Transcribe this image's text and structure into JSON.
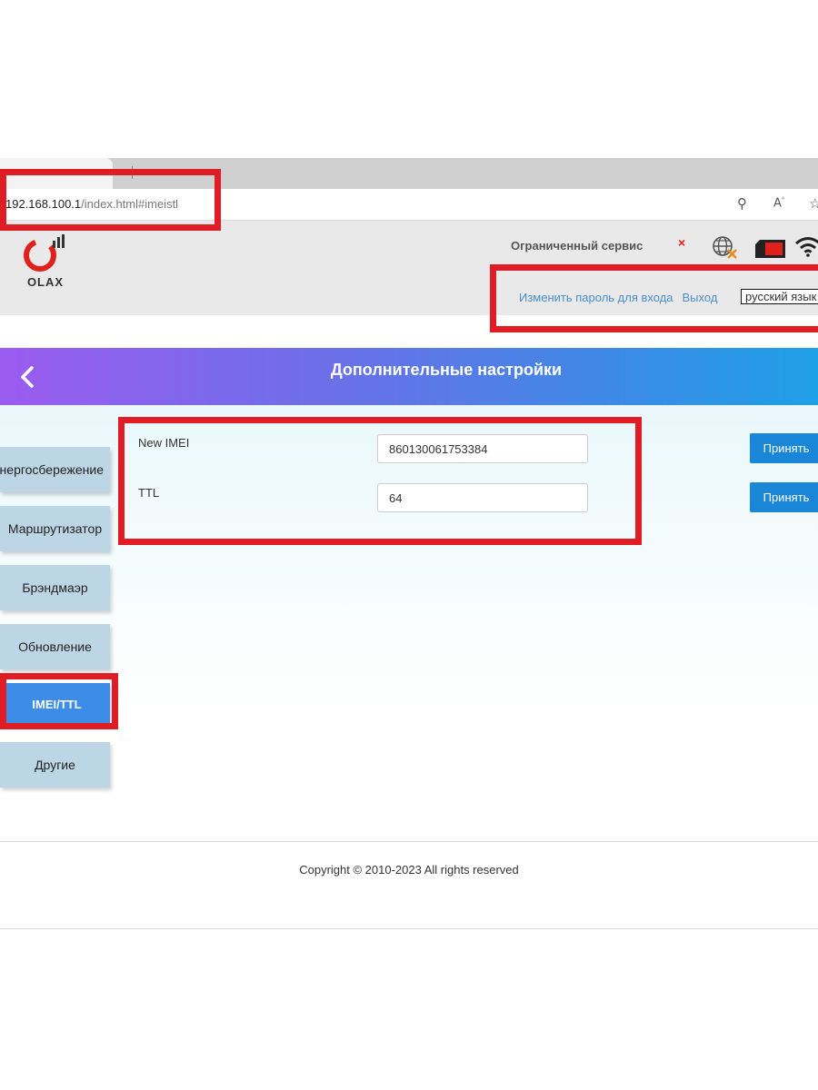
{
  "browser": {
    "url_host": "192.168.100.1",
    "url_path": "/index.html#imeistl",
    "icons": [
      "key-icon",
      "read-aloud-icon",
      "favorite-star-icon"
    ]
  },
  "header": {
    "logo_text": "OLAX",
    "service_status": "Ограниченный сервис",
    "service_status_mark": "×",
    "status_color": "#e0201b",
    "links": {
      "change_password": "Изменить пароль для входа",
      "logout": "Выход"
    },
    "language": "русский язык"
  },
  "banner": {
    "title": "Дополнительные настройки",
    "gradient_colors": [
      "#9b5cf0",
      "#1ea0e6"
    ]
  },
  "sidebar": {
    "items": [
      {
        "label": "Энергосбережение"
      },
      {
        "label": "Маршрутизатор"
      },
      {
        "label": "Брэндмаэр"
      },
      {
        "label": "Обновление"
      },
      {
        "label": "IMEI/TTL"
      },
      {
        "label": "Другие"
      }
    ],
    "active_index": 4
  },
  "form": {
    "imei_label": "New IMEI",
    "imei_value": "860130061753384",
    "ttl_label": "TTL",
    "ttl_value": "64",
    "apply_label": "Принять"
  },
  "footer": {
    "copyright": "Copyright © 2010-2023 All rights reserved"
  },
  "colors": {
    "accent": "#1a86d8",
    "highlight": "#e01c24",
    "link": "#4a8fca"
  }
}
